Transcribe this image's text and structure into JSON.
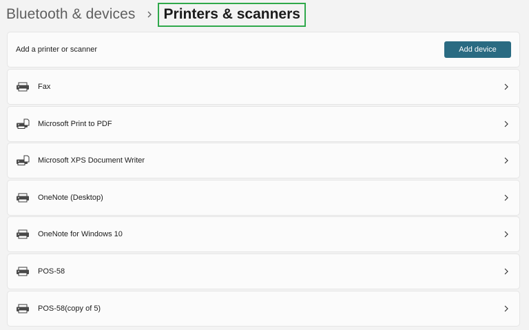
{
  "breadcrumb": {
    "parent": "Bluetooth & devices",
    "current": "Printers & scanners"
  },
  "add_section": {
    "label": "Add a printer or scanner",
    "button_label": "Add device"
  },
  "printers": [
    {
      "name": "Fax",
      "icon": "printer-icon"
    },
    {
      "name": "Microsoft Print to PDF",
      "icon": "printer-document-icon"
    },
    {
      "name": "Microsoft XPS Document Writer",
      "icon": "printer-document-icon"
    },
    {
      "name": "OneNote (Desktop)",
      "icon": "printer-icon"
    },
    {
      "name": "OneNote for Windows 10",
      "icon": "printer-icon"
    },
    {
      "name": "POS-58",
      "icon": "printer-icon"
    },
    {
      "name": "POS-58(copy of 5)",
      "icon": "printer-icon"
    }
  ],
  "colors": {
    "accent_button": "#2a6b82",
    "highlight_border": "#2ea84a"
  }
}
